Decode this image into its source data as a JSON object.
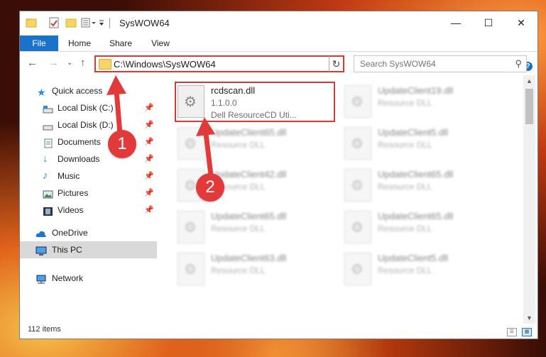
{
  "window": {
    "title": "SysWOW64",
    "minimize": "—",
    "maximize": "☐",
    "close": "✕"
  },
  "ribbon": {
    "tabs": [
      "File",
      "Home",
      "Share",
      "View"
    ],
    "expand": "⌄",
    "help": "?"
  },
  "nav": {
    "back": "←",
    "forward": "→",
    "recent": "⌄",
    "up": "↑",
    "address": "C:\\Windows\\SysWOW64",
    "address_dropdown": "⌄",
    "refresh": "↻",
    "search_placeholder": "Search SysWOW64"
  },
  "sidebar": {
    "items": [
      {
        "label": "Quick access",
        "icon": "star-icon"
      },
      {
        "label": "Local Disk (C:)",
        "icon": "drive-icon",
        "pinned": true
      },
      {
        "label": "Local Disk (D:)",
        "icon": "drive-icon",
        "pinned": true
      },
      {
        "label": "Documents",
        "icon": "documents-icon",
        "pinned": true
      },
      {
        "label": "Downloads",
        "icon": "download-icon",
        "pinned": true
      },
      {
        "label": "Music",
        "icon": "music-icon",
        "pinned": true
      },
      {
        "label": "Pictures",
        "icon": "pictures-icon",
        "pinned": true
      },
      {
        "label": "Videos",
        "icon": "videos-icon",
        "pinned": true
      },
      {
        "label": "OneDrive",
        "icon": "cloud-icon"
      },
      {
        "label": "This PC",
        "icon": "computer-icon",
        "selected": true
      },
      {
        "label": "Network",
        "icon": "network-icon"
      }
    ]
  },
  "files": [
    {
      "name": "rcdscan.dll",
      "version": "1.1.0.0",
      "desc": "Dell ResourceCD Uti..."
    },
    {
      "name": "UpdateClient19.dll",
      "desc": "Resource DLL"
    },
    {
      "name": "UpdateClient65.dll",
      "desc": "Resource DLL"
    },
    {
      "name": "UpdateClient5.dll",
      "desc": "Resource DLL"
    },
    {
      "name": "UpdateClient42.dll",
      "desc": "Resource DLL"
    },
    {
      "name": "UpdateClient65.dll",
      "desc": "Resource DLL"
    },
    {
      "name": "UpdateClient65.dll",
      "desc": "Resource DLL"
    },
    {
      "name": "UpdateClient65.dll",
      "desc": "Resource DLL"
    },
    {
      "name": "UpdateClient63.dll",
      "desc": "Resource DLL"
    },
    {
      "name": "UpdateClient5.dll",
      "desc": "Resource DLL"
    }
  ],
  "status": {
    "item_count": "112 items"
  },
  "annotations": {
    "step1": "1",
    "step2": "2"
  },
  "colors": {
    "accent": "#1a72c9",
    "highlight": "#d33b3b",
    "badge": "#e23a3a"
  }
}
